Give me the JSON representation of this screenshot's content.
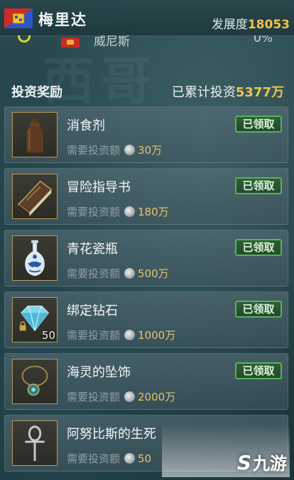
{
  "header": {
    "city_name": "梅里达",
    "development_label": "发展度",
    "development_value": "18053"
  },
  "strip": {
    "name": "威尼斯",
    "percent": "0%"
  },
  "rewards": {
    "title": "投资奖励",
    "total_label": "已累计投资",
    "total_value": "5377万"
  },
  "items": [
    {
      "name": "消食剂",
      "need_label": "需要投资额",
      "amount": "30万",
      "status": "已领取",
      "icon": "bottle-icon"
    },
    {
      "name": "冒险指导书",
      "need_label": "需要投资额",
      "amount": "180万",
      "status": "已领取",
      "icon": "book-icon"
    },
    {
      "name": "青花瓷瓶",
      "need_label": "需要投资额",
      "amount": "500万",
      "status": "已领取",
      "icon": "vase-icon"
    },
    {
      "name": "绑定钻石",
      "need_label": "需要投资额",
      "amount": "1000万",
      "status": "已领取",
      "icon": "diamond-icon",
      "qty": "50"
    },
    {
      "name": "海灵的坠饰",
      "need_label": "需要投资额",
      "amount": "2000万",
      "status": "已领取",
      "icon": "pendant-icon"
    },
    {
      "name": "阿努比斯的生死",
      "need_label": "需要投资额",
      "amount": "50",
      "icon": "ankh-icon"
    }
  ],
  "watermark": {
    "text": "九游"
  },
  "colors": {
    "accent_gold": "#f0c350",
    "claim_green": "#53b55a"
  }
}
